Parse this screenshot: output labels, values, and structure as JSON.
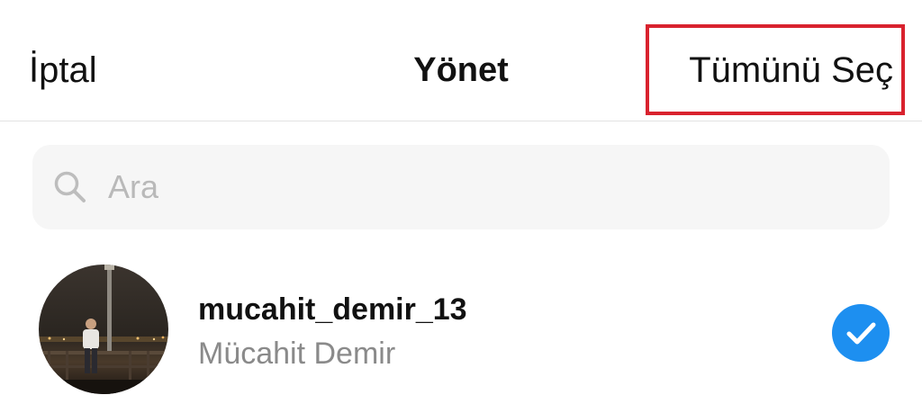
{
  "header": {
    "cancel_label": "İptal",
    "title": "Yönet",
    "select_all_label": "Tümünü Seç"
  },
  "search": {
    "placeholder": "Ara",
    "value": ""
  },
  "users": [
    {
      "username": "mucahit_demir_13",
      "full_name": "Mücahit Demir",
      "selected": true
    }
  ],
  "colors": {
    "highlight_border": "#d9222e",
    "check_fill": "#1d8ff0",
    "secondary_text": "#8a8a8a",
    "placeholder_text": "#b9b9b9",
    "search_background": "#f6f6f6"
  },
  "icons": {
    "search": "search-icon",
    "check": "checkmark-circle-icon"
  }
}
